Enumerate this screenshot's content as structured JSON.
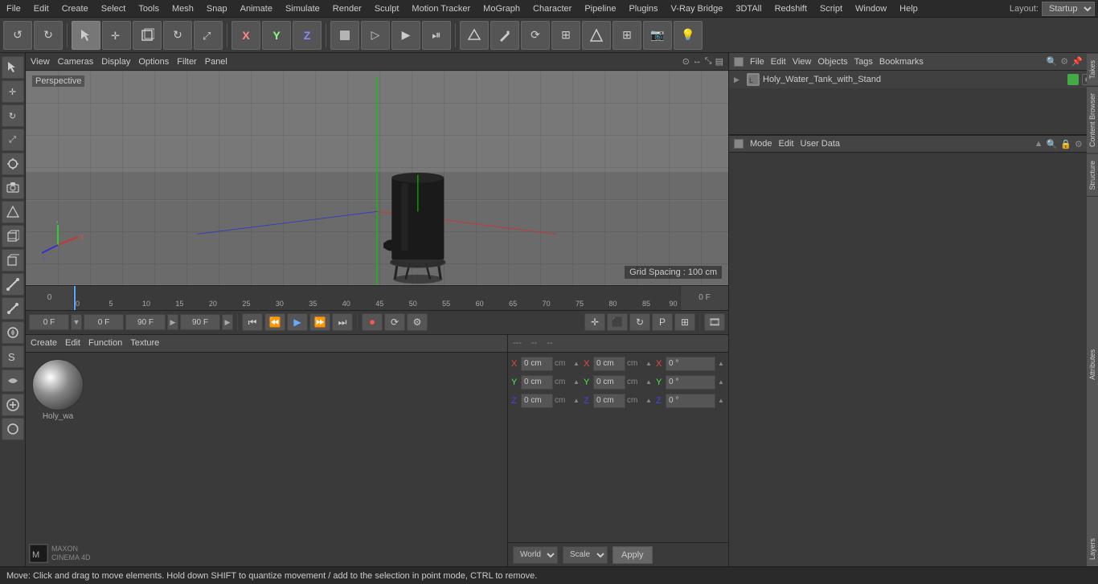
{
  "menubar": {
    "items": [
      "File",
      "Edit",
      "Create",
      "Select",
      "Tools",
      "Mesh",
      "Snap",
      "Animate",
      "Simulate",
      "Render",
      "Sculpt",
      "Motion Tracker",
      "MoGraph",
      "Character",
      "Pipeline",
      "Plugins",
      "V-Ray Bridge",
      "3DTAll",
      "Redshift",
      "Script",
      "Window",
      "Help"
    ],
    "layout_label": "Layout:",
    "layout_value": "Startup"
  },
  "toolbar": {
    "undo_label": "↺",
    "redo_label": "↻"
  },
  "viewport": {
    "label": "Perspective",
    "grid_spacing": "Grid Spacing : 100 cm",
    "view_menu": "View",
    "cameras_menu": "Cameras",
    "display_menu": "Display",
    "options_menu": "Options",
    "filter_menu": "Filter",
    "panel_menu": "Panel"
  },
  "timeline": {
    "ticks": [
      0,
      5,
      10,
      15,
      20,
      25,
      30,
      35,
      40,
      45,
      50,
      55,
      60,
      65,
      70,
      75,
      80,
      85,
      90
    ],
    "start_frame": "0 F",
    "end_frame": "0 F"
  },
  "playback": {
    "current_frame": "0 F",
    "start_frame": "0 F",
    "end_frame_1": "90 F",
    "end_frame_2": "90 F",
    "fps_display": ""
  },
  "material": {
    "create_label": "Create",
    "edit_label": "Edit",
    "function_label": "Function",
    "texture_label": "Texture",
    "sphere_name": "Holy_wa"
  },
  "coordinates": {
    "header_dots1": "---",
    "header_dots2": "--",
    "header_dots3": "--",
    "x_pos": "0 cm",
    "y_pos": "0 cm",
    "z_pos": "0 cm",
    "x_size": "0 cm",
    "y_size": "0 cm",
    "z_size": "0 cm",
    "x_rot": "0 °",
    "y_rot": "0 °",
    "z_rot": "0 °",
    "world_label": "World",
    "scale_label": "Scale",
    "apply_label": "Apply"
  },
  "objects_panel": {
    "file_menu": "File",
    "edit_menu": "Edit",
    "view_menu": "View",
    "objects_menu": "Objects",
    "tags_menu": "Tags",
    "bookmarks_menu": "Bookmarks",
    "object_name": "Holy_Water_Tank_with_Stand",
    "object_color": "#44aa44"
  },
  "attributes_panel": {
    "mode_label": "Mode",
    "edit_label": "Edit",
    "user_data_label": "User Data",
    "tab_attributes": "Attributes",
    "tab_layers": "Layers"
  },
  "status_bar": {
    "text": "Move: Click and drag to move elements. Hold down SHIFT to quantize movement / add to the selection in point mode, CTRL to remove."
  },
  "icons": {
    "arrow": "↑",
    "rotate": "↻",
    "scale": "⬛",
    "play": "▶",
    "stop": "■",
    "prev": "⏮",
    "next": "⏭",
    "step_back": "⏪",
    "step_fwd": "⏩",
    "record": "⏺",
    "loop": "🔁"
  }
}
